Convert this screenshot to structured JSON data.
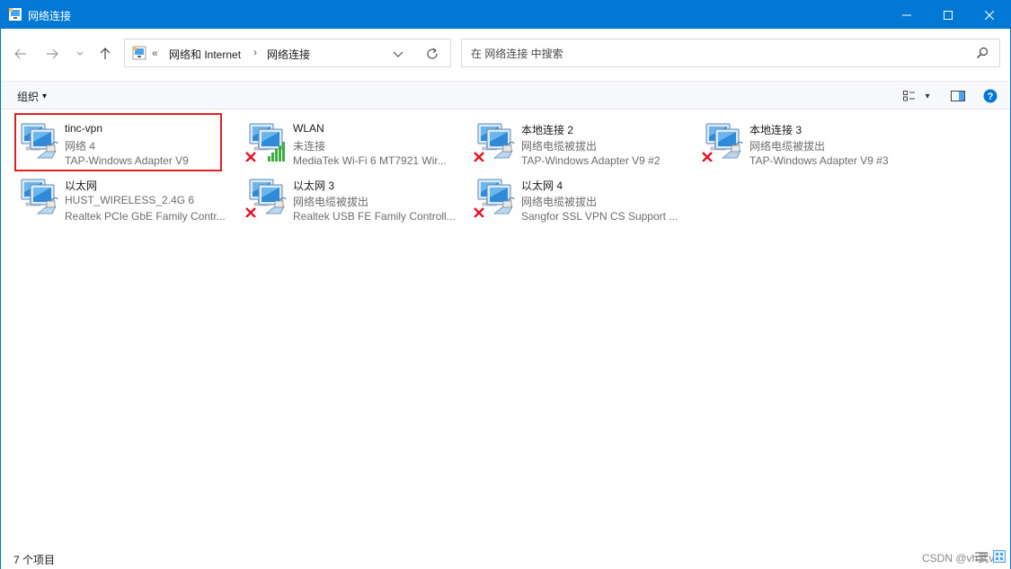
{
  "window": {
    "title": "网络连接"
  },
  "nav": {
    "back": "back-arrow",
    "forward": "forward-arrow",
    "recent": "chevron-down",
    "up": "up-arrow",
    "address": {
      "overflow": "«",
      "crumbs": [
        "网络和 Internet",
        "网络连接"
      ],
      "separator": "›"
    },
    "search_placeholder": "在 网络连接 中搜索"
  },
  "commandbar": {
    "organize_label": "组织",
    "organize_caret": "▾",
    "view_caret": "▾"
  },
  "connections": [
    {
      "name": "tinc-vpn",
      "status": "网络 4",
      "device": "TAP-Windows Adapter V9",
      "indicator": "none",
      "highlighted": true
    },
    {
      "name": "WLAN",
      "status": "未连接",
      "device": "MediaTek Wi-Fi 6 MT7921 Wir...",
      "indicator": "x-and-signal"
    },
    {
      "name": "本地连接 2",
      "status": "网络电缆被拔出",
      "device": "TAP-Windows Adapter V9 #2",
      "indicator": "x"
    },
    {
      "name": "本地连接 3",
      "status": "网络电缆被拔出",
      "device": "TAP-Windows Adapter V9 #3",
      "indicator": "x"
    },
    {
      "name": "以太网",
      "status": "HUST_WIRELESS_2.4G 6",
      "device": "Realtek PCIe GbE Family Contr...",
      "indicator": "none"
    },
    {
      "name": "以太网 3",
      "status": "网络电缆被拔出",
      "device": "Realtek USB FE Family Controll...",
      "indicator": "x"
    },
    {
      "name": "以太网 4",
      "status": "网络电缆被拔出",
      "device": "Sangfor SSL VPN CS Support ...",
      "indicator": "x"
    }
  ],
  "status": {
    "count": "7 个项目",
    "watermark": "CSDN @vh武v"
  },
  "colors": {
    "titlebar": "#0078d4",
    "highlight": "#e02020",
    "error": "#e81123",
    "help": "#0078d4"
  }
}
